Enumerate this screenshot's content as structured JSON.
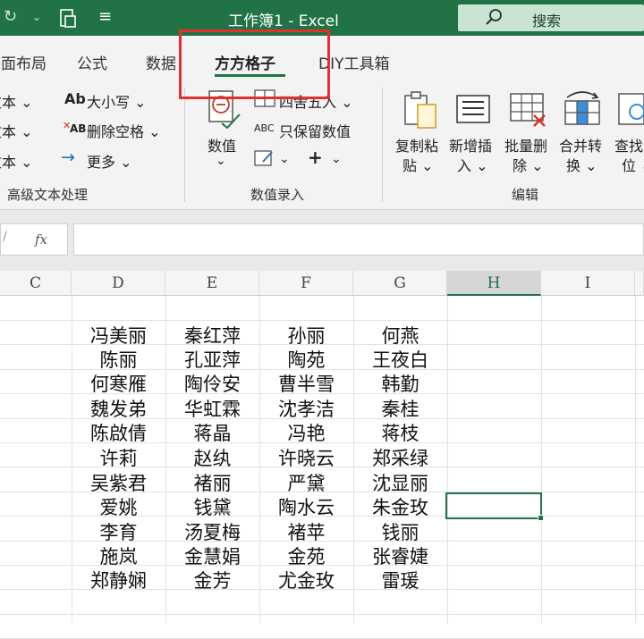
{
  "window": {
    "title": "工作簿1  -  Excel",
    "search_label": "搜索"
  },
  "tabs": [
    {
      "label": "页面布局"
    },
    {
      "label": "公式"
    },
    {
      "label": "数据"
    },
    {
      "label": "方方格子",
      "active": true
    },
    {
      "label": "DIY工具箱"
    }
  ],
  "ribbon": {
    "left_truncated": [
      "文本 ⌄",
      "文本 ⌄",
      "文本 ⌄"
    ],
    "text_group": {
      "case_label": "大小写 ⌄",
      "trim_label": "删除空格 ⌄",
      "more_label": "更多 ⌄",
      "group_label": "高级文本处理"
    },
    "number_group": {
      "value_label": "数值",
      "value_arrow": "⌄",
      "round_label": "四舍五入  ⌄",
      "keep_label": "只保留数值",
      "fx_arrow": "⌄",
      "plus_arrow": "⌄",
      "group_label": "数值录入"
    },
    "edit_group": {
      "buttons": [
        {
          "line1": "复制粘",
          "line2": "贴 ⌄"
        },
        {
          "line1": "新增插",
          "line2": "入 ⌄"
        },
        {
          "line1": "批量删",
          "line2": "除 ⌄"
        },
        {
          "line1": "合并转",
          "line2": "换 ⌄"
        },
        {
          "line1": "查找定",
          "line2": "位 ⌄"
        }
      ],
      "group_label": "编辑"
    }
  },
  "formula_bar": {
    "fx_label": "fx"
  },
  "columns": [
    "C",
    "D",
    "E",
    "F",
    "G",
    "H",
    "I"
  ],
  "selected_column": "H",
  "sheet": {
    "D": [
      "冯美丽",
      "陈丽",
      "何寒雁",
      "魏发弟",
      "陈啟倩",
      "许莉",
      "吴紫君",
      "爱姚",
      "李育",
      "施岚",
      "郑静娴"
    ],
    "E": [
      "秦红萍",
      "孔亚萍",
      "陶伶安",
      "华虹霖",
      "蒋晶",
      "赵纨",
      "褚丽",
      "钱黛",
      "汤夏梅",
      "金慧娟",
      "金芳"
    ],
    "F": [
      "孙丽",
      "陶苑",
      "曹半雪",
      "沈孝洁",
      "冯艳",
      "许晓云",
      "严黛",
      "陶水云",
      "褚苹",
      "金苑",
      "尤金玫"
    ],
    "G": [
      "何燕",
      "王夜白",
      "韩勤",
      "秦桂",
      "蒋枝",
      "郑采绿",
      "沈显丽",
      "朱金玫",
      "钱丽",
      "张睿婕",
      "雷瑗"
    ]
  },
  "colors": {
    "accent": "#217346",
    "highlight_box": "#e0312d"
  }
}
